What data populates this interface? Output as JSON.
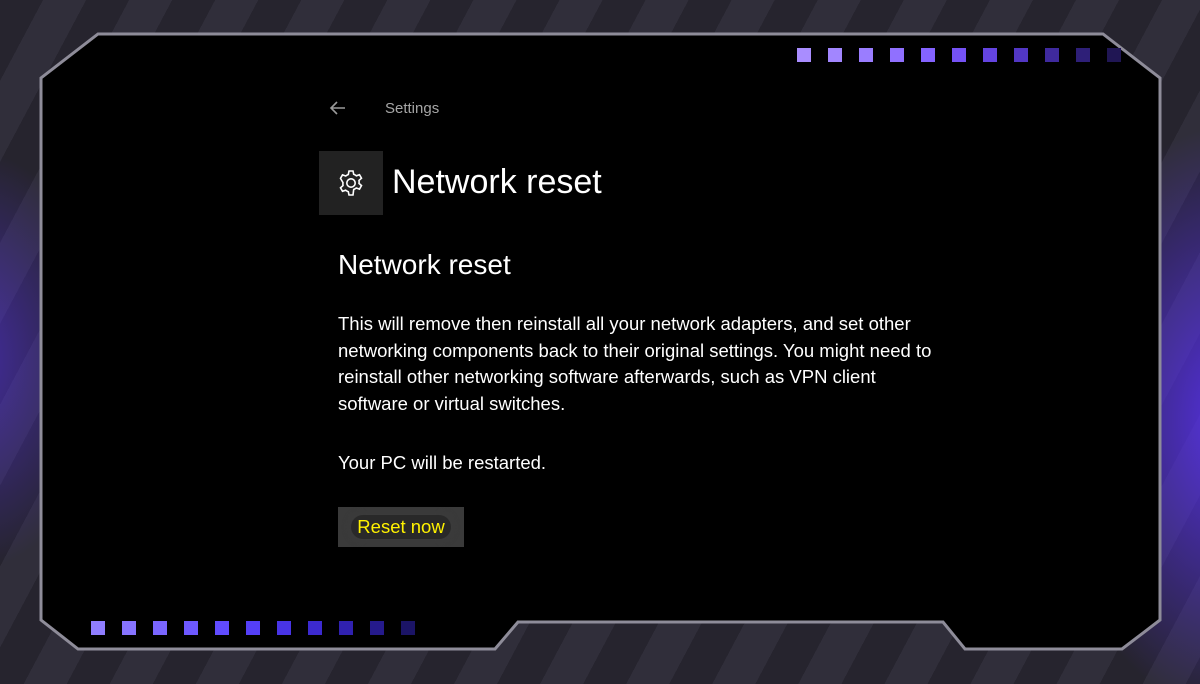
{
  "header": {
    "back_icon": "back-arrow-icon",
    "breadcrumb": "Settings"
  },
  "page": {
    "icon": "gear-icon",
    "title": "Network reset"
  },
  "section": {
    "title": "Network reset",
    "description": "This will remove then reinstall all your network adapters, and set other networking components back to their original settings. You might need to reinstall other networking software afterwards, such as VPN client software or virtual switches.",
    "note": "Your PC will be restarted.",
    "reset_button_label": "Reset now"
  },
  "colors": {
    "highlight_text": "#fff200",
    "accent_purple": "#5c32ff",
    "frame_border": "#8e8c99"
  }
}
